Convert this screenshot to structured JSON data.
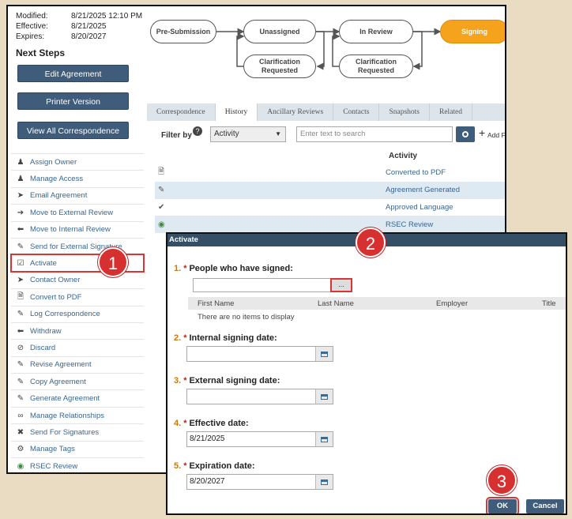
{
  "meta": {
    "modified_label": "Modified:",
    "modified_value": "8/21/2025 12:10 PM",
    "effective_label": "Effective:",
    "effective_value": "8/21/2025",
    "expires_label": "Expires:",
    "expires_value": "8/20/2027"
  },
  "next_steps": {
    "title": "Next Steps",
    "buttons": [
      "Edit Agreement",
      "Printer Version",
      "View All Correspondence"
    ],
    "actions": [
      {
        "label": "Assign Owner",
        "icon": "person-add-icon"
      },
      {
        "label": "Manage Access",
        "icon": "people-icon"
      },
      {
        "label": "Email Agreement",
        "icon": "send-icon"
      },
      {
        "label": "Move to External Review",
        "icon": "arrow-right-icon"
      },
      {
        "label": "Move to Internal Review",
        "icon": "arrow-left-icon"
      },
      {
        "label": "Send for External Signature",
        "icon": "pen-icon"
      },
      {
        "label": "Activate",
        "icon": "checkbox-icon"
      },
      {
        "label": "Contact Owner",
        "icon": "send-icon"
      },
      {
        "label": "Convert to PDF",
        "icon": "pdf-icon"
      },
      {
        "label": "Log Correspondence",
        "icon": "edit-icon"
      },
      {
        "label": "Withdraw",
        "icon": "arrow-left-icon"
      },
      {
        "label": "Discard",
        "icon": "ban-icon"
      },
      {
        "label": "Revise Agreement",
        "icon": "edit-icon"
      },
      {
        "label": "Copy Agreement",
        "icon": "edit-icon"
      },
      {
        "label": "Generate Agreement",
        "icon": "edit-icon"
      },
      {
        "label": "Manage Relationships",
        "icon": "link-icon"
      },
      {
        "label": "Send For Signatures",
        "icon": "tools-icon"
      },
      {
        "label": "Manage Tags",
        "icon": "gear-icon"
      },
      {
        "label": "RSEC Review",
        "icon": "globe-icon"
      }
    ]
  },
  "workflow": {
    "states": [
      "Pre-Submission",
      "Unassigned",
      "In Review",
      "Signing",
      "Clarification Requested",
      "Clarification Requested"
    ],
    "current": "Signing"
  },
  "tabs": [
    "Correspondence",
    "History",
    "Ancillary Reviews",
    "Contacts",
    "Snapshots",
    "Related"
  ],
  "active_tab": "History",
  "filter": {
    "label": "Filter by",
    "select_value": "Activity",
    "search_placeholder": "Enter text to search",
    "add_filter": "Add Filter"
  },
  "history": {
    "column": "Activity",
    "rows": [
      "Converted to PDF",
      "Agreement Generated",
      "Approved Language",
      "RSEC Review"
    ]
  },
  "dialog": {
    "title": "Activate",
    "fields": [
      {
        "num": "1.",
        "label": "People who have signed:"
      },
      {
        "num": "2.",
        "label": "Internal signing date:",
        "value": ""
      },
      {
        "num": "3.",
        "label": "External signing date:",
        "value": ""
      },
      {
        "num": "4.",
        "label": "Effective date:",
        "value": "8/21/2025"
      },
      {
        "num": "5.",
        "label": "Expiration date:",
        "value": "8/20/2027"
      }
    ],
    "browse_button": "...",
    "people_columns": [
      "First Name",
      "Last Name",
      "Employer",
      "Title"
    ],
    "people_empty": "There are no items to display",
    "ok": "OK",
    "cancel": "Cancel"
  },
  "callouts": [
    "1",
    "2",
    "3"
  ],
  "colors": {
    "accent": "#3f5c7a",
    "current_state": "#f5a21c",
    "callout": "#d63030",
    "link": "#3a6690"
  }
}
